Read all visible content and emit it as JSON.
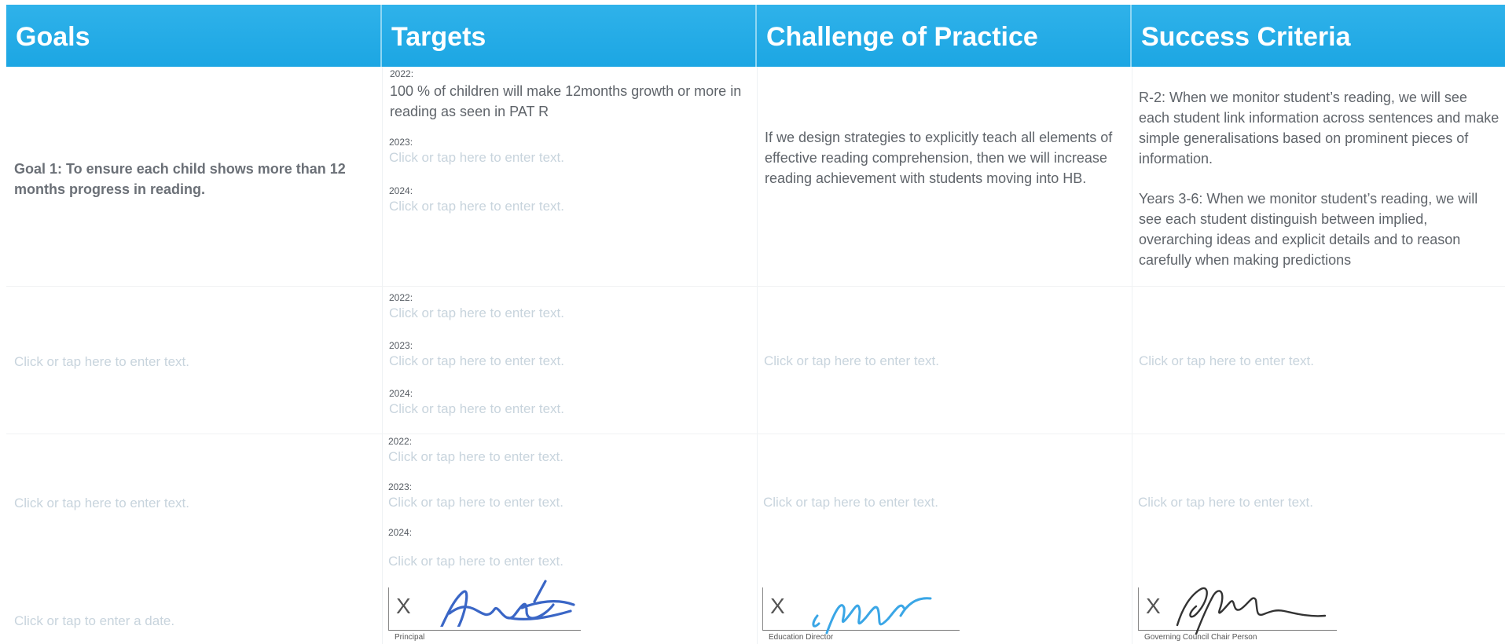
{
  "header": {
    "goals": "Goals",
    "targets": "Targets",
    "challenge": "Challenge of Practice",
    "success": "Success Criteria"
  },
  "row1": {
    "goal": "Goal 1: To ensure each child shows more than 12 months progress in reading.",
    "target_2022_label": "2022:",
    "target_2022_text": "100 % of children will make 12months growth or more in reading as seen in PAT R",
    "target_2023_label": "2023:",
    "target_2023_text": "Click or tap here to enter text.",
    "target_2024_label": "2024:",
    "target_2024_text": "Click or tap here to enter text.",
    "challenge": "If we design strategies to explicitly teach all elements of effective reading comprehension, then we will increase reading achievement with students moving into HB.",
    "success_1": "R-2:  When we monitor student’s reading, we will see each student link information across sentences and make simple generalisations based on prominent pieces of information.",
    "success_2": "Years 3-6:  When we monitor student’s reading, we will see each student distinguish between implied, overarching ideas and explicit details and to reason carefully when making predictions"
  },
  "row2": {
    "goal": "Click or tap here to enter text.",
    "target_2022_label": "2022:",
    "target_2022_text": "Click or tap here to enter text.",
    "target_2023_label": "2023:",
    "target_2023_text": "Click or tap here to enter text.",
    "target_2024_label": "2024:",
    "target_2024_text": "Click or tap here to enter text.",
    "challenge": "Click or tap here to enter text.",
    "success": "Click or tap here to enter text."
  },
  "row3": {
    "goal": "Click or tap here to enter text.",
    "target_2022_label": "2022:",
    "target_2022_text": "Click or tap here to enter text.",
    "target_2023_label": "2023:",
    "target_2023_text": "Click or tap here to enter text.",
    "target_2024_label": "2024:",
    "target_2024_text": "Click or tap here to enter text.",
    "challenge": "Click or tap here to enter text.",
    "success": "Click or tap here to enter text."
  },
  "footer": {
    "date": "Click or tap to enter a date.",
    "sig_x": "X",
    "principal_label": "Principal",
    "director_label": "Education Director",
    "chair_label": "Governing Council Chair Person"
  },
  "colors": {
    "header_bg": "#1ca6e3",
    "header_text": "#ffffff",
    "placeholder": "#c8d4dd",
    "body_text": "#5f646a"
  }
}
